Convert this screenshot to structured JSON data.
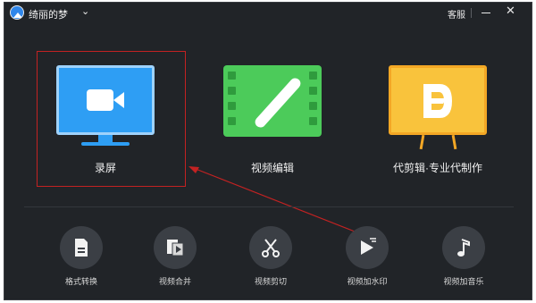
{
  "titlebar": {
    "username": "绮丽的梦",
    "service_label": "客服"
  },
  "features": [
    {
      "label": "录屏",
      "icon": "screen-record-icon"
    },
    {
      "label": "视频编辑",
      "icon": "video-edit-icon"
    },
    {
      "label": "代剪辑·专业代制作",
      "icon": "pro-editing-icon"
    }
  ],
  "tools": [
    {
      "label": "格式转换",
      "icon": "format-convert-icon"
    },
    {
      "label": "视频合并",
      "icon": "video-merge-icon"
    },
    {
      "label": "视频剪切",
      "icon": "scissors-icon"
    },
    {
      "label": "视频加水印",
      "icon": "watermark-icon"
    },
    {
      "label": "视频加音乐",
      "icon": "music-note-icon"
    }
  ],
  "colors": {
    "background": "#212428",
    "record_blue": "#2e9ef4",
    "edit_green": "#4ccb5a",
    "pro_yellow": "#f9c33c",
    "annotation_red": "#c32222"
  }
}
